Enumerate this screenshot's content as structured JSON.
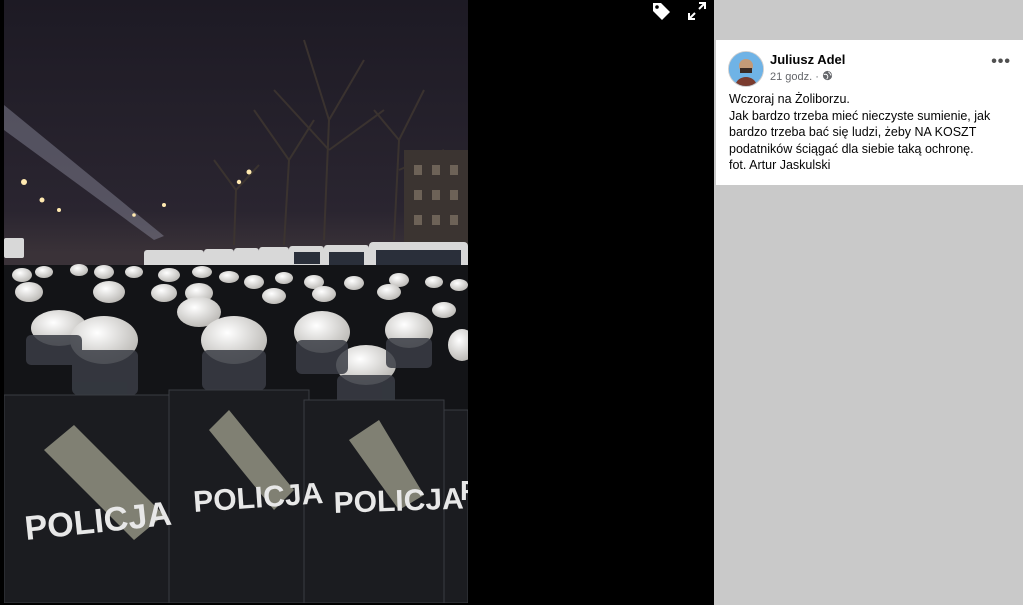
{
  "post": {
    "author": "Juliusz Adel",
    "time": "21 godz.",
    "privacy_icon": "globe-icon",
    "more_icon": "more-options-icon",
    "text_lines": [
      "Wczoraj na Żoliborzu.",
      "Jak bardzo trzeba mieć nieczyste sumienie, jak",
      "bardzo trzeba bać się ludzi, żeby NA KOSZT",
      "podatników ściągać dla siebie taką ochronę.",
      "fot. Artur Jaskulski"
    ]
  },
  "photo": {
    "shield_labels": [
      "POLICJA",
      "POLICJA",
      "POLICJA",
      "P"
    ]
  },
  "viewer": {
    "tag_icon": "tag-icon",
    "fullscreen_icon": "fullscreen-icon"
  }
}
